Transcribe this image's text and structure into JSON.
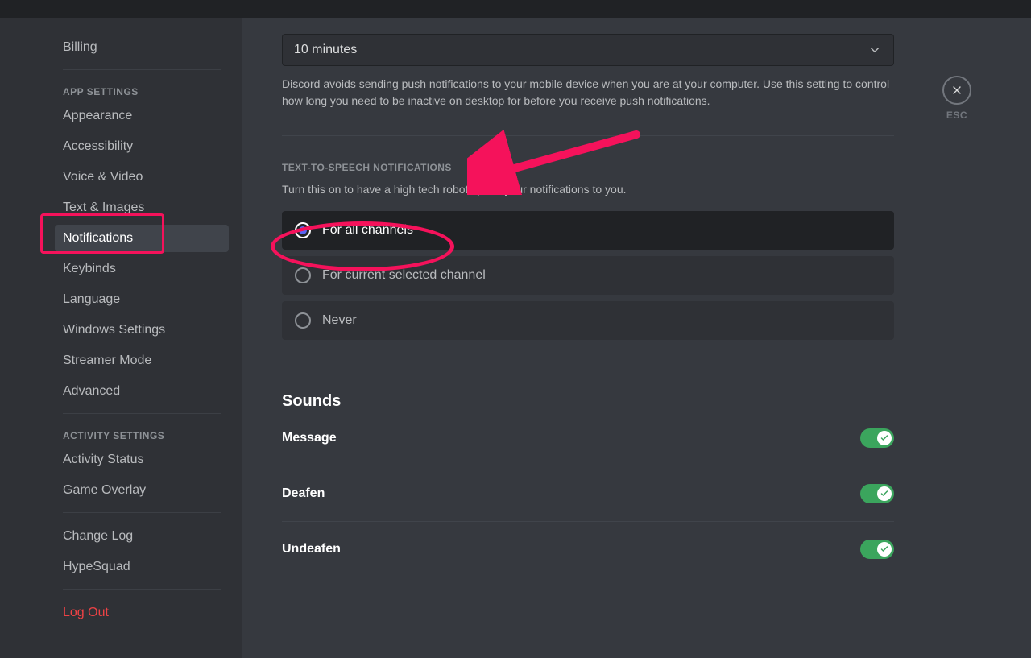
{
  "sidebar": {
    "billing": "Billing",
    "app_settings_header": "App Settings",
    "app_items": [
      "Appearance",
      "Accessibility",
      "Voice & Video",
      "Text & Images",
      "Notifications",
      "Keybinds",
      "Language",
      "Windows Settings",
      "Streamer Mode",
      "Advanced"
    ],
    "activity_header": "Activity Settings",
    "activity_items": [
      "Activity Status",
      "Game Overlay"
    ],
    "misc_items": [
      "Change Log",
      "HypeSquad"
    ],
    "logout": "Log Out"
  },
  "timeout": {
    "selected": "10 minutes",
    "description": "Discord avoids sending push notifications to your mobile device when you are at your computer. Use this setting to control how long you need to be inactive on desktop for before you receive push notifications."
  },
  "tts": {
    "header": "Text-to-Speech Notifications",
    "description": "Turn this on to have a high tech robot speak your notifications to you.",
    "options": [
      "For all channels",
      "For current selected channel",
      "Never"
    ]
  },
  "sounds": {
    "header": "Sounds",
    "items": [
      "Message",
      "Deafen",
      "Undeafen"
    ]
  },
  "esc_label": "ESC"
}
